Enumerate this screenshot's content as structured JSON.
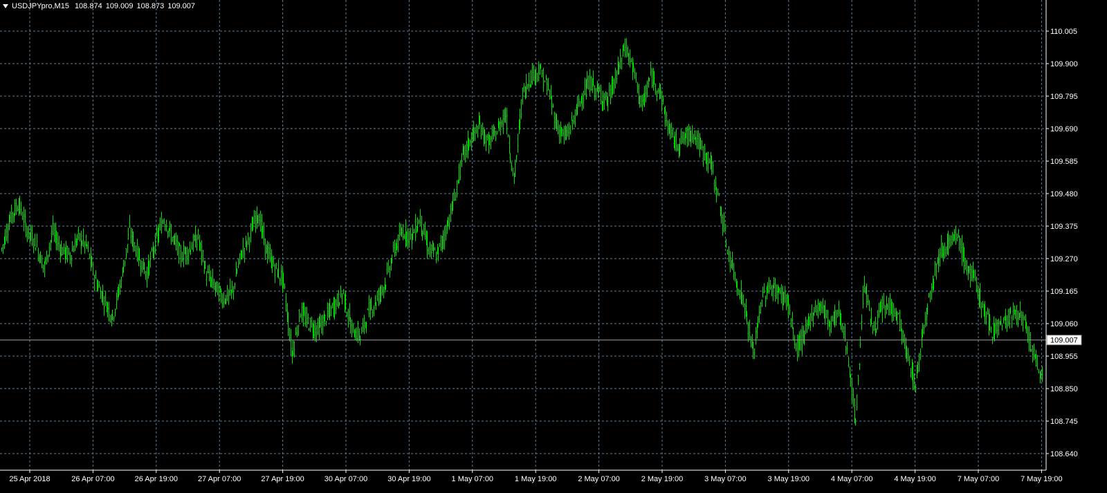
{
  "window": {
    "symbol": "USDJPYpro,M15",
    "ohlc": [
      "108.874",
      "109.009",
      "108.873",
      "109.007"
    ],
    "menu_icon": "triangle-down-icon"
  },
  "colors": {
    "background": "#000000",
    "grid": "#5f7f99",
    "bars": "#00e000",
    "axis": "#ffffff",
    "current_price_line": "#a0a0a0"
  },
  "chart_data": {
    "type": "line",
    "symbol": "USDJPYpro",
    "timeframe": "M15",
    "current_price": "109.007",
    "y_ticks": [
      "110.005",
      "109.900",
      "109.795",
      "109.690",
      "109.585",
      "109.480",
      "109.375",
      "109.270",
      "109.165",
      "109.060",
      "108.955",
      "108.850",
      "108.745",
      "108.640"
    ],
    "x_ticks": [
      "25 Apr 2018",
      "26 Apr 07:00",
      "26 Apr 19:00",
      "27 Apr 07:00",
      "27 Apr 19:00",
      "30 Apr 07:00",
      "30 Apr 19:00",
      "1 May 07:00",
      "1 May 19:00",
      "2 May 07:00",
      "2 May 19:00",
      "3 May 07:00",
      "3 May 19:00",
      "4 May 07:00",
      "4 May 19:00",
      "7 May 07:00",
      "7 May 19:00"
    ],
    "ylim": [
      108.64,
      110.005
    ],
    "series": [
      {
        "values": [
          109.3,
          109.4,
          109.45,
          109.36,
          109.32,
          109.24,
          109.36,
          109.3,
          109.28,
          109.34,
          109.31,
          109.2,
          109.14,
          109.08,
          109.2,
          109.36,
          109.28,
          109.22,
          109.32,
          109.4,
          109.34,
          109.28,
          109.3,
          109.34,
          109.22,
          109.18,
          109.14,
          109.16,
          109.28,
          109.34,
          109.42,
          109.3,
          109.24,
          109.2,
          108.96,
          109.1,
          109.06,
          109.04,
          109.08,
          109.12,
          109.16,
          109.04,
          109.02,
          109.1,
          109.14,
          109.2,
          109.3,
          109.36,
          109.34,
          109.4,
          109.3,
          109.28,
          109.36,
          109.46,
          109.6,
          109.66,
          109.7,
          109.64,
          109.68,
          109.74,
          109.52,
          109.8,
          109.86,
          109.88,
          109.82,
          109.7,
          109.66,
          109.72,
          109.8,
          109.84,
          109.8,
          109.78,
          109.86,
          109.96,
          109.88,
          109.76,
          109.86,
          109.82,
          109.7,
          109.64,
          109.66,
          109.68,
          109.62,
          109.58,
          109.46,
          109.3,
          109.2,
          109.12,
          108.96,
          109.14,
          109.18,
          109.16,
          109.14,
          108.98,
          109.02,
          109.1,
          109.12,
          109.06,
          109.1,
          108.98,
          108.74,
          109.2,
          109.04,
          109.1,
          109.12,
          109.08,
          108.96,
          108.86,
          109.06,
          109.2,
          109.3,
          109.32,
          109.34,
          109.24,
          109.2,
          109.1,
          109.04,
          109.06,
          109.08,
          109.1,
          109.04,
          108.94,
          108.88
        ]
      }
    ]
  }
}
